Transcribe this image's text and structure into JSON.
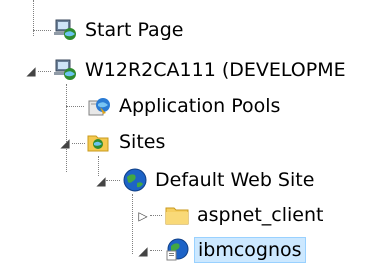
{
  "tree": {
    "items": [
      {
        "label": "Start Page",
        "icon": "start-page-icon",
        "expander": ""
      },
      {
        "label": "W12R2CA111 (DEVELOPME",
        "icon": "server-icon",
        "expander": "◢"
      },
      {
        "label": "Application Pools",
        "icon": "application-pools-icon",
        "expander": ""
      },
      {
        "label": "Sites",
        "icon": "sites-folder-icon",
        "expander": "◢"
      },
      {
        "label": "Default Web Site",
        "icon": "globe-icon",
        "expander": "◢"
      },
      {
        "label": "aspnet_client",
        "icon": "folder-icon",
        "expander": "▷"
      },
      {
        "label": "ibmcognos",
        "icon": "virtual-directory-icon",
        "expander": "◢"
      }
    ]
  }
}
